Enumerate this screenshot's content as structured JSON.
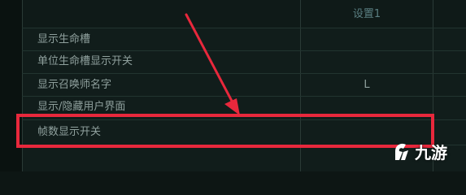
{
  "table": {
    "column_header": "设置1",
    "rows": [
      {
        "label": "显示生命槽",
        "value": ""
      },
      {
        "label": "单位生命槽显示开关",
        "value": ""
      },
      {
        "label": "显示召唤师名字",
        "value": "L"
      },
      {
        "label": "显示/隐藏用户界面",
        "value": ""
      },
      {
        "label": "帧数显示开关",
        "value": ""
      }
    ]
  },
  "annotation": {
    "highlight_color": "#e8283c",
    "arrow_color": "#e8283c"
  },
  "watermark": {
    "text": "九游",
    "icon": "jiuyou-logo-icon"
  }
}
